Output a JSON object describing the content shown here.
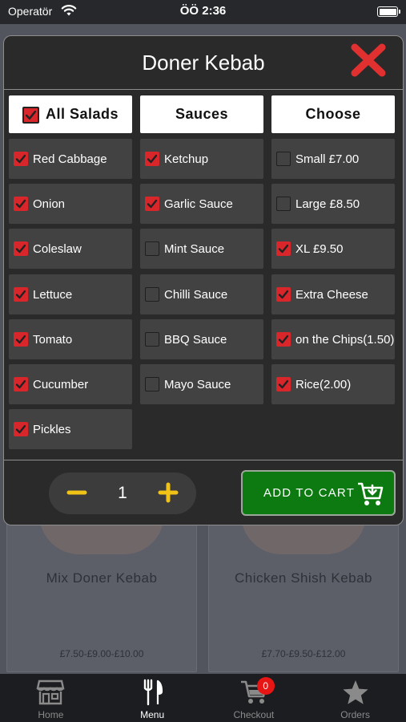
{
  "status_bar": {
    "carrier": "Operatör",
    "time": "ÖÖ 2:36"
  },
  "modal": {
    "title": "Doner Kebab",
    "columns": {
      "salads": {
        "header": "All Salads",
        "header_checked": true
      },
      "sauces": {
        "header": "Sauces"
      },
      "choose": {
        "header": "Choose"
      }
    },
    "salads": [
      {
        "label": "Red Cabbage",
        "checked": true
      },
      {
        "label": "Onion",
        "checked": true
      },
      {
        "label": "Coleslaw",
        "checked": true
      },
      {
        "label": "Lettuce",
        "checked": true
      },
      {
        "label": "Tomato",
        "checked": true
      },
      {
        "label": "Cucumber",
        "checked": true
      },
      {
        "label": "Pickles",
        "checked": true
      }
    ],
    "sauces": [
      {
        "label": "Ketchup",
        "checked": true
      },
      {
        "label": "Garlic Sauce",
        "checked": true
      },
      {
        "label": "Mint Sauce",
        "checked": false
      },
      {
        "label": "Chilli Sauce",
        "checked": false
      },
      {
        "label": "BBQ Sauce",
        "checked": false
      },
      {
        "label": "Mayo Sauce",
        "checked": false
      }
    ],
    "choose": [
      {
        "label": "Small £7.00",
        "checked": false
      },
      {
        "label": "Large £8.50",
        "checked": false
      },
      {
        "label": "XL £9.50",
        "checked": true
      },
      {
        "label": "Extra Cheese",
        "checked": true
      },
      {
        "label": "on the Chips(1.50)",
        "checked": true
      },
      {
        "label": "Rice(2.00)",
        "checked": true
      }
    ],
    "quantity": "1",
    "add_to_cart_label": "ADD TO CART"
  },
  "background_menu": [
    {
      "name": "Mix Doner Kebab",
      "price": "£7.50-£9.00-£10.00"
    },
    {
      "name": "Chicken Shish Kebab",
      "price": "£7.70-£9.50-£12.00"
    }
  ],
  "tab_bar": {
    "tabs": [
      {
        "label": "Home",
        "icon": "store-icon"
      },
      {
        "label": "Menu",
        "icon": "fork-knife-icon",
        "active": true
      },
      {
        "label": "Checkout",
        "icon": "cart-icon",
        "badge": "0"
      },
      {
        "label": "Orders",
        "icon": "star-icon"
      }
    ]
  },
  "colors": {
    "accent_red": "#d8262b",
    "close_red": "#e0302f",
    "stepper_yellow": "#f2c317",
    "cart_green": "#0c7a10"
  }
}
